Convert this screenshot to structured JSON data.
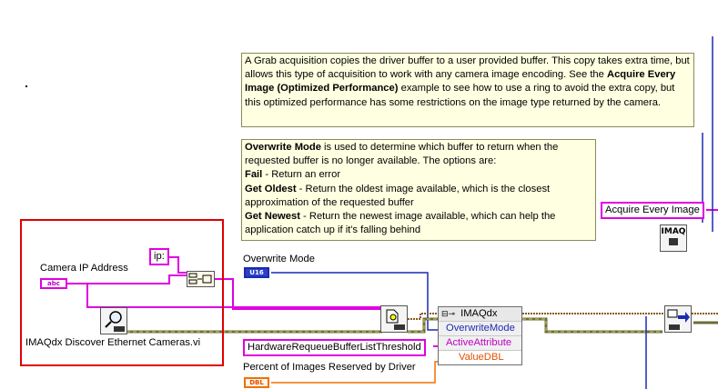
{
  "comments": {
    "grab_acquisition": {
      "text_before": "A Grab acquisition copies the driver buffer to a user provided buffer. This copy takes extra time, but allows this type of acquisition to work with any camera image encoding. See the ",
      "bold": "Acquire Every Image (Optimized Performance)",
      "text_after": " example to see how to use a ring to avoid the extra copy, but this optimized performance has some restrictions on the image type returned by the camera."
    },
    "overwrite_mode": {
      "title": "Overwrite Mode",
      "intro": " is used to determine which buffer to return when the requested buffer is no longer available. The options are:",
      "fail_label": "Fail",
      "fail_desc": " - Return an error",
      "oldest_label": "Get Oldest",
      "oldest_desc": " - Return the oldest image available, which is the closest approximation of the requested buffer",
      "newest_label": "Get Newest",
      "newest_desc": " - Return the newest image available, which can help the application catch up if it's falling behind"
    }
  },
  "controls": {
    "camera_ip_label": "Camera IP Address",
    "camera_ip_terminal": "abc",
    "overwrite_mode_label": "Overwrite Mode",
    "overwrite_mode_terminal": "U16",
    "percent_images_label": "Percent of Images Reserved by Driver",
    "percent_images_terminal": "DBL"
  },
  "constants": {
    "ip_prefix": "ip:",
    "acquire_every_image": "Acquire Every Image",
    "buffer_threshold": "HardwareRequeueBufferListThreshold"
  },
  "subvis": {
    "discover_cameras": "IMAQdx Discover Ethernet Cameras.vi",
    "imaq_icon_text": "IMAQ"
  },
  "property_node": {
    "title": "IMAQdx",
    "properties": [
      "OverwriteMode",
      "ActiveAttribute",
      "ValueDBL"
    ]
  },
  "colors": {
    "comment_bg": "#ffffe1",
    "string_wire": "#e000e0",
    "enum_wire": "#1a2bb0",
    "double_wire": "#f07000",
    "highlight_box": "#e00000"
  }
}
